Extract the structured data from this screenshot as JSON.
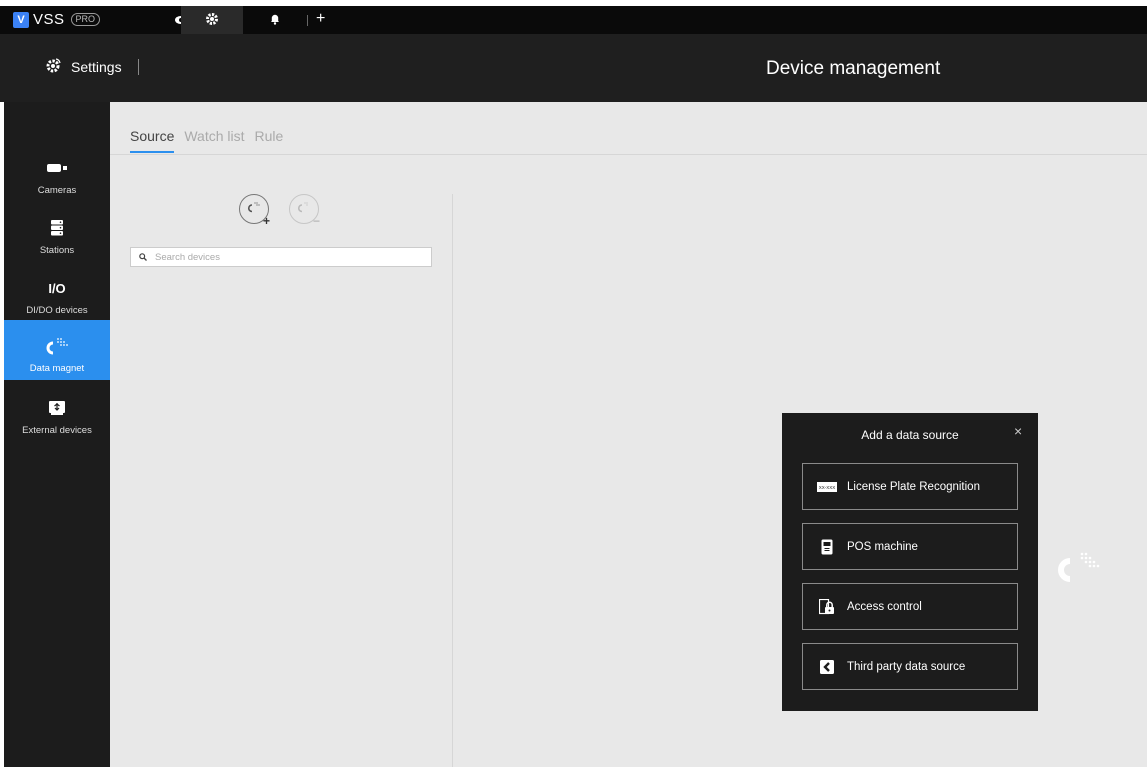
{
  "topbar": {
    "brand_text": "VSS",
    "brand_badge": "PRO",
    "brand_mark": "V",
    "tabs": [
      {
        "icon": "eye-icon",
        "active": false
      },
      {
        "icon": "gear-icon",
        "active": true
      },
      {
        "icon": "bell-icon",
        "active": false
      }
    ],
    "add_tab_label": "+"
  },
  "header": {
    "settings_label": "Settings",
    "page_title": "Device management"
  },
  "sidebar": {
    "items": [
      {
        "label": "Cameras",
        "icon": "camera-icon"
      },
      {
        "label": "Stations",
        "icon": "server-icon"
      },
      {
        "label": "DI/DO devices",
        "icon_text": "I/O"
      },
      {
        "label": "Data magnet",
        "icon": "magnet-icon",
        "active": true
      },
      {
        "label": "External devices",
        "icon": "usb-device-icon"
      }
    ]
  },
  "main": {
    "tabs": [
      {
        "label": "Source",
        "active": true
      },
      {
        "label": "Watch list",
        "active": false
      },
      {
        "label": "Rule",
        "active": false
      }
    ],
    "search_placeholder": "Search devices",
    "add_button_badge": "+",
    "remove_button_badge": "−"
  },
  "dialog": {
    "title": "Add a data source",
    "close_label": "×",
    "options": [
      {
        "label": "License Plate Recognition",
        "icon": "license-plate-icon",
        "icon_text": "XX-XXX"
      },
      {
        "label": "POS machine",
        "icon": "pos-icon"
      },
      {
        "label": "Access control",
        "icon": "lock-icon"
      },
      {
        "label": "Third party data source",
        "icon": "third-party-icon"
      }
    ]
  },
  "colors": {
    "accent": "#2b8fee",
    "topbar_bg": "#0a0a0a",
    "header_bg": "#1f1f1f",
    "sidebar_bg": "#1c1c1c",
    "content_bg": "#e8e8e8",
    "dialog_bg": "#1c1c1c"
  }
}
